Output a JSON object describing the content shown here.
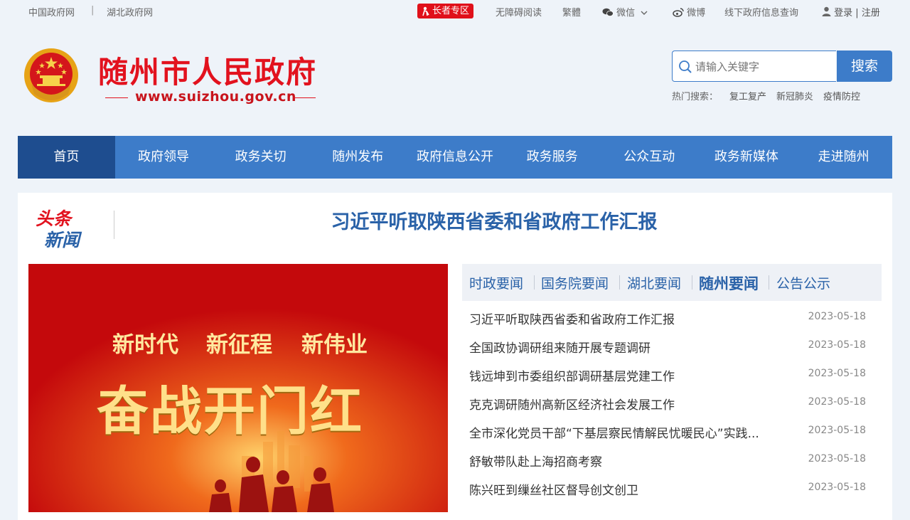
{
  "topbar": {
    "link_gov": "中国政府网",
    "sep": "|",
    "link_hubei": "湖北政府网",
    "elder": "长者专区",
    "accessible": "无障碍阅读",
    "traditional": "繁體",
    "wechat": "微信",
    "weibo": "微博",
    "offline": "线下政府信息查询",
    "login": "登录",
    "login_sep": "|",
    "register": "注册"
  },
  "header": {
    "title": "随州市人民政府",
    "url": "www.suizhou.gov.cn"
  },
  "search": {
    "placeholder": "请输入关键字",
    "button": "搜索",
    "hot_label": "热门搜索：",
    "hot_items": [
      "复工复产",
      "新冠肺炎",
      "疫情防控"
    ]
  },
  "nav": {
    "items": [
      "首页",
      "政府领导",
      "政务关切",
      "随州发布",
      "政府信息公开",
      "政务服务",
      "公众互动",
      "政务新媒体",
      "走进随州"
    ]
  },
  "headline": {
    "logo_top": "头条",
    "logo_bottom": "新闻",
    "title": "习近平听取陕西省委和省政府工作汇报"
  },
  "banner": {
    "sub1": "新时代",
    "sub2": "新征程",
    "sub3": "新伟业",
    "main": "奋战开门红"
  },
  "tabs": [
    "时政要闻",
    "国务院要闻",
    "湖北要闻",
    "随州要闻",
    "公告公示"
  ],
  "news": [
    {
      "title": "习近平听取陕西省委和省政府工作汇报",
      "date": "2023-05-18"
    },
    {
      "title": "全国政协调研组来随开展专题调研",
      "date": "2023-05-18"
    },
    {
      "title": "钱远坤到市委组织部调研基层党建工作",
      "date": "2023-05-18"
    },
    {
      "title": "克克调研随州高新区经济社会发展工作",
      "date": "2023-05-18"
    },
    {
      "title": "全市深化党员干部“下基层察民情解民忧暖民心”实践...",
      "date": "2023-05-18"
    },
    {
      "title": "舒敏带队赴上海招商考察",
      "date": "2023-05-18"
    },
    {
      "title": "陈兴旺到缫丝社区督导创文创卫",
      "date": "2023-05-18"
    }
  ],
  "colors": {
    "brand_red": "#e2121e",
    "nav_blue": "#3d7cc9",
    "nav_active": "#1e4d8f",
    "link_blue": "#2a62a8"
  },
  "icons": [
    "elder-icon",
    "wechat-icon",
    "chevron-down-icon",
    "weibo-icon",
    "user-icon",
    "search-icon",
    "national-emblem"
  ]
}
